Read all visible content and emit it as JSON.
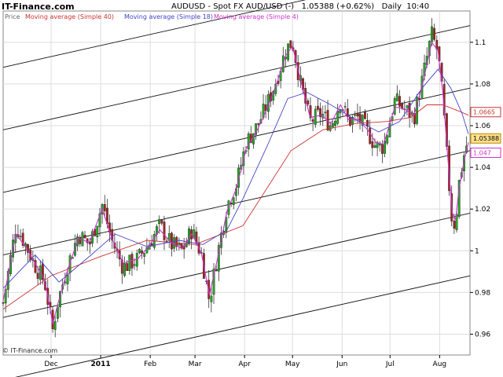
{
  "header": {
    "site_name": "IT-Finance.com",
    "title": "AUDUSD - Spot FX AUD/USD (-)   1.05388 (+0.62%)   Daily  10:40"
  },
  "watermark": "© IT-Finance.com",
  "chart_data": {
    "type": "candlestick",
    "symbol": "AUDUSD",
    "last": "1.05388",
    "change": "(+0.62%)",
    "ylim": [
      0.95,
      1.115
    ],
    "y_ticks": [
      0.96,
      0.98,
      1.0,
      1.02,
      1.04,
      1.06,
      1.08,
      1.1
    ],
    "y_tick_labels": [
      "0.96",
      "0.98",
      "1",
      "1.02",
      "1.04",
      "1.06",
      "1.08",
      "1.1"
    ],
    "x_ticks": [
      {
        "label": "Dec",
        "day": 30,
        "bold": false
      },
      {
        "label": "2011",
        "day": 61,
        "bold": true
      },
      {
        "label": "Feb",
        "day": 92,
        "bold": false
      },
      {
        "label": "Mar",
        "day": 120,
        "bold": false
      },
      {
        "label": "Apr",
        "day": 151,
        "bold": false
      },
      {
        "label": "May",
        "day": 181,
        "bold": false
      },
      {
        "label": "Jun",
        "day": 212,
        "bold": false
      },
      {
        "label": "Jul",
        "day": 242,
        "bold": false
      },
      {
        "label": "Aug",
        "day": 273,
        "bold": false
      }
    ],
    "x_range": [
      0,
      292
    ],
    "grid": true,
    "legend": [
      {
        "name": "Price",
        "color": "#666666"
      },
      {
        "name": "Moving average (Simple 40)",
        "color": "#cc3333"
      },
      {
        "name": "Moving average (Simple 18)",
        "color": "#4444cc"
      },
      {
        "name": "Moving average (Simple 4)",
        "color": "#cc33cc"
      }
    ],
    "channel_lines": [
      {
        "y_start": 1.088,
        "y_end": 1.138
      },
      {
        "y_start": 1.058,
        "y_end": 1.108
      },
      {
        "y_start": 1.028,
        "y_end": 1.078
      },
      {
        "y_start": 0.998,
        "y_end": 1.048
      },
      {
        "y_start": 0.968,
        "y_end": 1.018
      },
      {
        "y_start": 0.938,
        "y_end": 0.988
      }
    ],
    "price_path": [
      [
        0,
        0.975
      ],
      [
        8,
        1.012
      ],
      [
        14,
        1.003
      ],
      [
        20,
        0.993
      ],
      [
        26,
        0.985
      ],
      [
        31,
        0.962
      ],
      [
        34,
        0.975
      ],
      [
        40,
        0.992
      ],
      [
        47,
        1.008
      ],
      [
        54,
        1.003
      ],
      [
        62,
        1.022
      ],
      [
        68,
        1.005
      ],
      [
        75,
        0.992
      ],
      [
        84,
        0.996
      ],
      [
        91,
        1.003
      ],
      [
        98,
        1.012
      ],
      [
        105,
        1.003
      ],
      [
        112,
        1.0
      ],
      [
        118,
        1.01
      ],
      [
        124,
        0.998
      ],
      [
        129,
        0.976
      ],
      [
        134,
        0.998
      ],
      [
        140,
        1.022
      ],
      [
        146,
        1.032
      ],
      [
        152,
        1.052
      ],
      [
        159,
        1.06
      ],
      [
        165,
        1.07
      ],
      [
        171,
        1.082
      ],
      [
        177,
        1.097
      ],
      [
        181,
        1.1
      ],
      [
        186,
        1.08
      ],
      [
        192,
        1.062
      ],
      [
        199,
        1.066
      ],
      [
        205,
        1.06
      ],
      [
        211,
        1.072
      ],
      [
        216,
        1.062
      ],
      [
        222,
        1.064
      ],
      [
        228,
        1.057
      ],
      [
        233,
        1.05
      ],
      [
        238,
        1.05
      ],
      [
        245,
        1.072
      ],
      [
        251,
        1.068
      ],
      [
        257,
        1.064
      ],
      [
        263,
        1.085
      ],
      [
        268,
        1.104
      ],
      [
        272,
        1.095
      ],
      [
        275,
        1.072
      ],
      [
        278,
        1.04
      ],
      [
        281,
        1.012
      ],
      [
        283,
        1.014
      ],
      [
        285,
        1.032
      ],
      [
        288,
        1.045
      ],
      [
        291,
        1.05388
      ]
    ],
    "ma40_path": [
      [
        0,
        0.972
      ],
      [
        30,
        0.988
      ],
      [
        60,
        0.997
      ],
      [
        90,
        1.005
      ],
      [
        120,
        1.003
      ],
      [
        150,
        1.012
      ],
      [
        165,
        1.03
      ],
      [
        180,
        1.048
      ],
      [
        200,
        1.058
      ],
      [
        220,
        1.061
      ],
      [
        240,
        1.062
      ],
      [
        255,
        1.064
      ],
      [
        265,
        1.07
      ],
      [
        275,
        1.07
      ],
      [
        285,
        1.067
      ],
      [
        291,
        1.065
      ]
    ],
    "ma18_path": [
      [
        0,
        0.982
      ],
      [
        20,
        0.998
      ],
      [
        35,
        0.985
      ],
      [
        55,
        0.998
      ],
      [
        70,
        1.008
      ],
      [
        90,
        1.002
      ],
      [
        110,
        1.005
      ],
      [
        125,
        1.003
      ],
      [
        140,
        1.01
      ],
      [
        150,
        1.025
      ],
      [
        165,
        1.05
      ],
      [
        178,
        1.073
      ],
      [
        190,
        1.076
      ],
      [
        205,
        1.07
      ],
      [
        220,
        1.063
      ],
      [
        235,
        1.057
      ],
      [
        248,
        1.062
      ],
      [
        262,
        1.078
      ],
      [
        272,
        1.087
      ],
      [
        280,
        1.078
      ],
      [
        287,
        1.066
      ],
      [
        291,
        1.056
      ]
    ],
    "ma4_path": [
      [
        0,
        0.976
      ],
      [
        8,
        1.008
      ],
      [
        14,
        1.002
      ],
      [
        20,
        0.994
      ],
      [
        26,
        0.986
      ],
      [
        31,
        0.965
      ],
      [
        34,
        0.974
      ],
      [
        40,
        0.99
      ],
      [
        47,
        1.006
      ],
      [
        54,
        1.004
      ],
      [
        62,
        1.02
      ],
      [
        68,
        1.006
      ],
      [
        75,
        0.994
      ],
      [
        84,
        0.996
      ],
      [
        91,
        1.002
      ],
      [
        98,
        1.01
      ],
      [
        105,
        1.004
      ],
      [
        112,
        1.001
      ],
      [
        118,
        1.008
      ],
      [
        124,
        0.999
      ],
      [
        129,
        0.979
      ],
      [
        134,
        0.996
      ],
      [
        140,
        1.019
      ],
      [
        146,
        1.03
      ],
      [
        152,
        1.049
      ],
      [
        159,
        1.058
      ],
      [
        165,
        1.068
      ],
      [
        171,
        1.08
      ],
      [
        177,
        1.094
      ],
      [
        181,
        1.098
      ],
      [
        186,
        1.082
      ],
      [
        192,
        1.064
      ],
      [
        199,
        1.065
      ],
      [
        205,
        1.061
      ],
      [
        211,
        1.07
      ],
      [
        216,
        1.063
      ],
      [
        222,
        1.063
      ],
      [
        228,
        1.058
      ],
      [
        233,
        1.052
      ],
      [
        238,
        1.051
      ],
      [
        245,
        1.069
      ],
      [
        251,
        1.068
      ],
      [
        257,
        1.065
      ],
      [
        263,
        1.082
      ],
      [
        268,
        1.1
      ],
      [
        272,
        1.096
      ],
      [
        275,
        1.076
      ],
      [
        278,
        1.046
      ],
      [
        281,
        1.018
      ],
      [
        283,
        1.015
      ],
      [
        285,
        1.029
      ],
      [
        288,
        1.042
      ],
      [
        291,
        1.052
      ]
    ],
    "badges": [
      {
        "label": "1.0665",
        "value": 1.0665,
        "color": "#cc3333"
      },
      {
        "label": "1.05388",
        "value": 1.05388,
        "color": "#bb8800",
        "fill": "#ffe08a"
      },
      {
        "label": "1.047",
        "value": 1.047,
        "color": "#cc33cc"
      }
    ]
  }
}
